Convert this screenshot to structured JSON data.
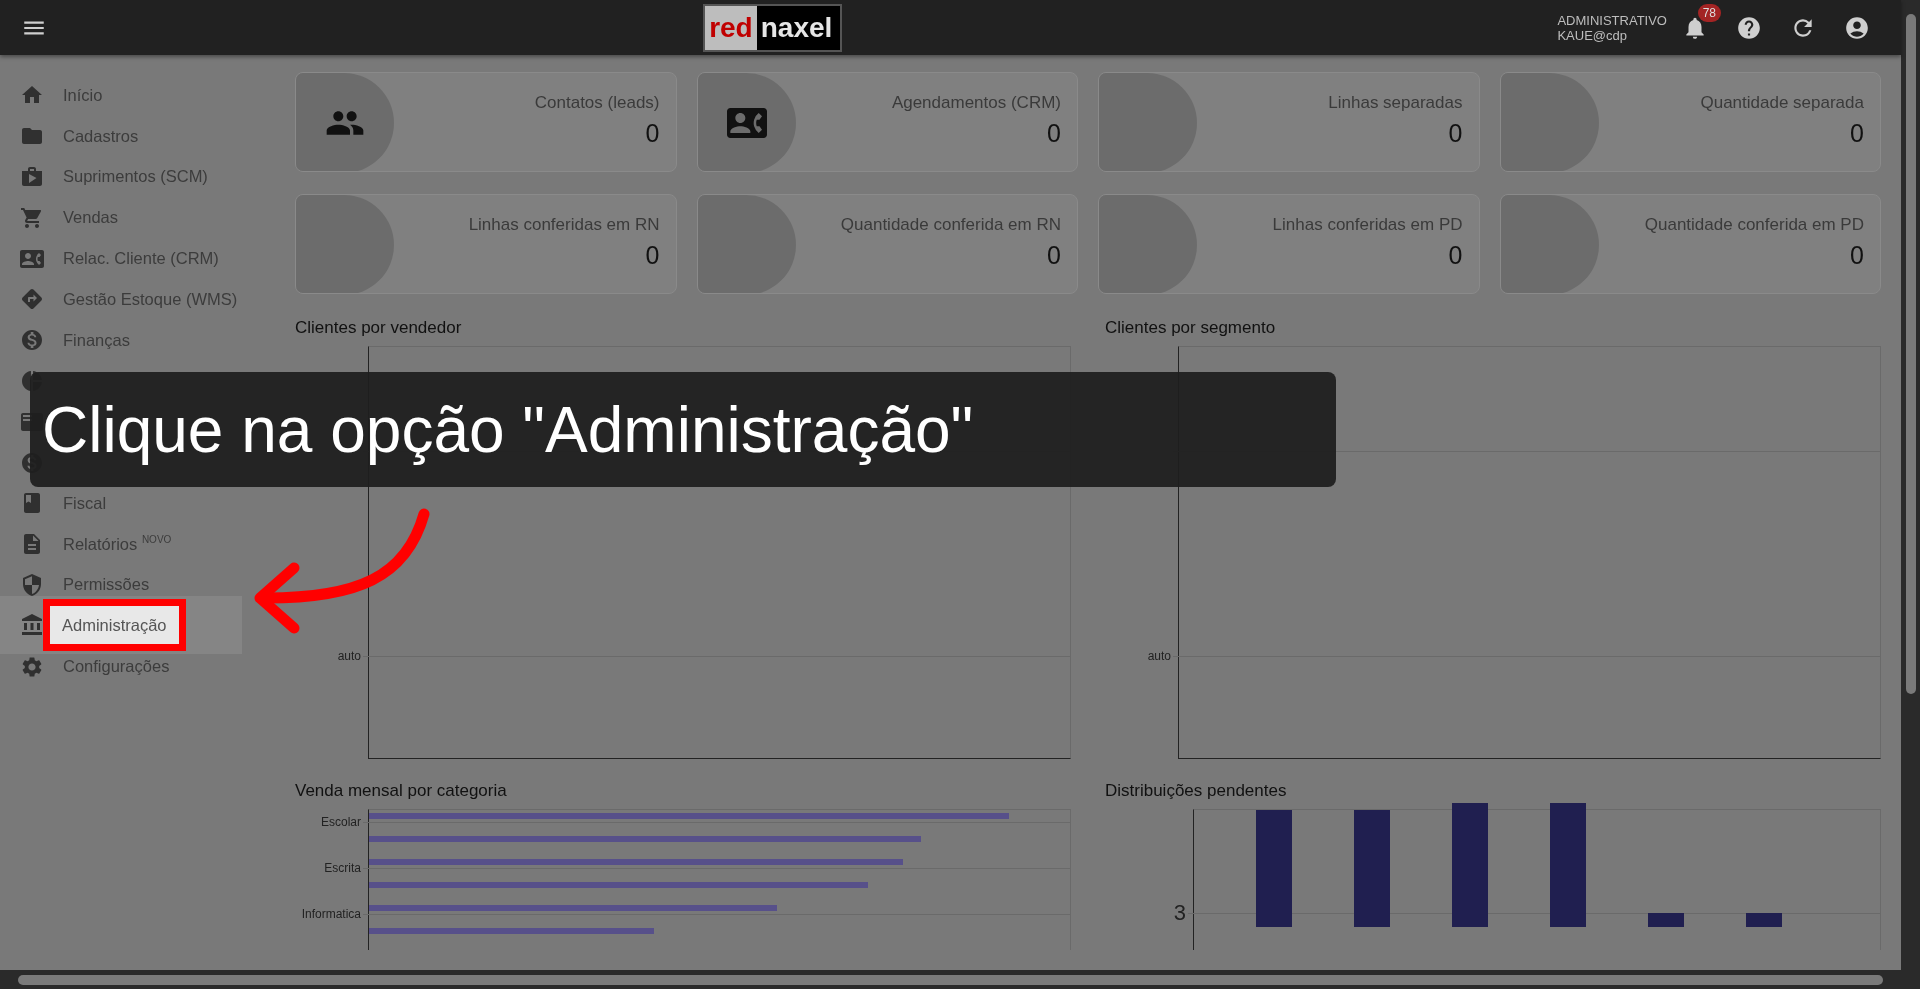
{
  "topbar": {
    "logo_left": "red",
    "logo_right": "naxel",
    "user_role": "ADMINISTRATIVO",
    "user_name": "KAUE@cdp",
    "notifications": "78"
  },
  "sidebar": {
    "items": [
      {
        "label": "Início",
        "selected": false
      },
      {
        "label": "Cadastros",
        "selected": false
      },
      {
        "label": "Suprimentos (SCM)",
        "selected": false
      },
      {
        "label": "Vendas",
        "selected": false
      },
      {
        "label": "Relac. Cliente (CRM)",
        "selected": false
      },
      {
        "label": "Gestão Estoque (WMS)",
        "selected": false
      },
      {
        "label": "Finanças",
        "selected": false
      },
      {
        "selected": false
      },
      {
        "selected": false
      },
      {
        "selected": false
      },
      {
        "label": "Fiscal",
        "selected": false
      },
      {
        "label": "Relatórios $^{NOVO}$",
        "selected": false
      },
      {
        "label": "Permissões",
        "selected": false
      },
      {
        "label": "Administração",
        "selected": true
      },
      {
        "label": "Configurações",
        "selected": false
      }
    ]
  },
  "cards": [
    {
      "label": "Contatos (leads)",
      "value": "0"
    },
    {
      "label": "Agendamentos (CRM)",
      "value": "0"
    },
    {
      "label": "Linhas separadas",
      "value": "0"
    },
    {
      "label": "Quantidade separada",
      "value": "0"
    },
    {
      "label": "Linhas conferidas em RN",
      "value": "0"
    },
    {
      "label": "Quantidade conferida em RN",
      "value": "0"
    },
    {
      "label": "Linhas conferidas em PD",
      "value": "0"
    },
    {
      "label": "Quantidade conferida em PD",
      "value": "0"
    }
  ],
  "charts": [
    {
      "title": "Clientes por vendedor",
      "kind": "empty",
      "ticks": [
        "auto"
      ]
    },
    {
      "title": "Clientes por segmento",
      "kind": "empty",
      "ticks": [
        "auto"
      ]
    },
    {
      "title": "Venda mensal por categoria",
      "kind": "hbars",
      "ticks": [
        "Escolar",
        "Escrita",
        "Informatica"
      ]
    },
    {
      "title": "Distribuições pendentes",
      "kind": "vbars",
      "ticks": [
        "3"
      ]
    }
  ],
  "callout": {
    "text": "Clique na opção \"Administração\""
  }
}
